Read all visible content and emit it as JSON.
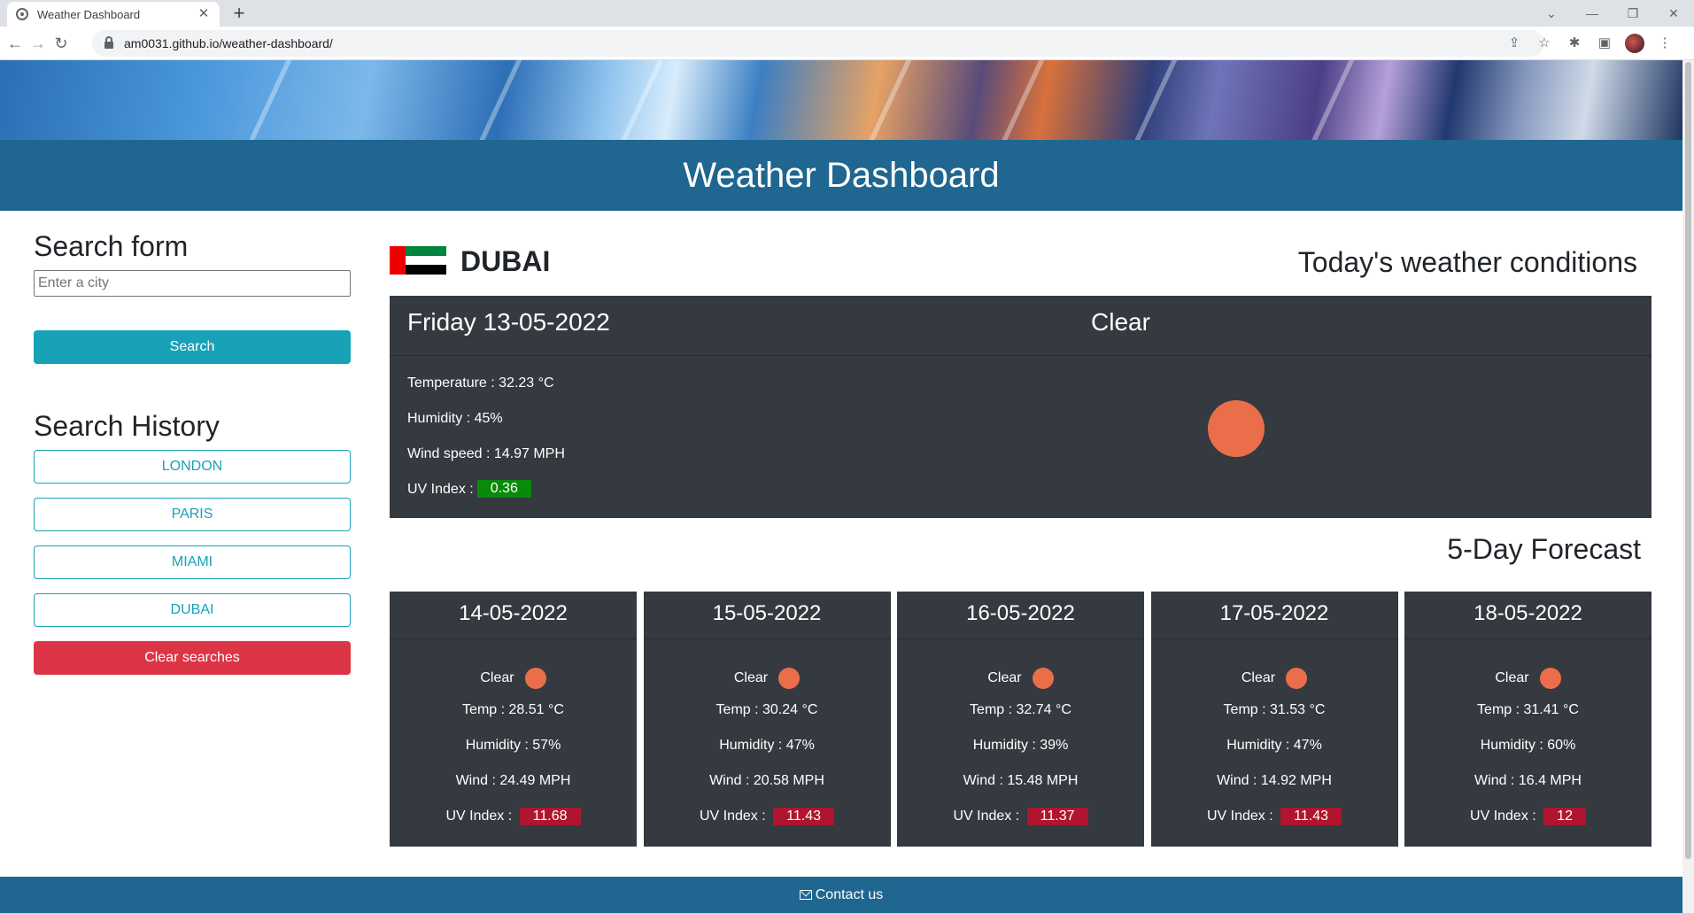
{
  "browser": {
    "tab_title": "Weather Dashboard",
    "tab_close": "✕",
    "new_tab": "+",
    "url": "am0031.github.io/weather-dashboard/"
  },
  "header": {
    "title": "Weather Dashboard"
  },
  "search": {
    "heading": "Search form",
    "placeholder": "Enter a city",
    "value": "",
    "button_label": "Search"
  },
  "history": {
    "heading": "Search History",
    "items": [
      "LONDON",
      "PARIS",
      "MIAMI",
      "DUBAI"
    ],
    "clear_label": "Clear searches"
  },
  "current": {
    "city": "DUBAI",
    "heading": "Today's weather conditions",
    "date": "Friday 13-05-2022",
    "condition": "Clear",
    "temperature": "Temperature : 32.23 °C",
    "humidity": "Humidity : 45%",
    "wind": "Wind speed : 14.97 MPH",
    "uv_label": "UV Index :",
    "uv_value": "0.36",
    "icon": "sun-icon"
  },
  "forecast": {
    "heading": "5-Day Forecast",
    "days": [
      {
        "date": "14-05-2022",
        "condition": "Clear",
        "temp": "Temp : 28.51 °C",
        "humidity": "Humidity : 57%",
        "wind": "Wind : 24.49 MPH",
        "uv_label": "UV Index :",
        "uv": "11.68"
      },
      {
        "date": "15-05-2022",
        "condition": "Clear",
        "temp": "Temp : 30.24 °C",
        "humidity": "Humidity : 47%",
        "wind": "Wind : 20.58 MPH",
        "uv_label": "UV Index :",
        "uv": "11.43"
      },
      {
        "date": "16-05-2022",
        "condition": "Clear",
        "temp": "Temp : 32.74 °C",
        "humidity": "Humidity : 39%",
        "wind": "Wind : 15.48 MPH",
        "uv_label": "UV Index :",
        "uv": "11.37"
      },
      {
        "date": "17-05-2022",
        "condition": "Clear",
        "temp": "Temp : 31.53 °C",
        "humidity": "Humidity : 47%",
        "wind": "Wind : 14.92 MPH",
        "uv_label": "UV Index :",
        "uv": "11.43"
      },
      {
        "date": "18-05-2022",
        "condition": "Clear",
        "temp": "Temp : 31.41 °C",
        "humidity": "Humidity : 60%",
        "wind": "Wind : 16.4 MPH",
        "uv_label": "UV Index :",
        "uv": "12"
      }
    ]
  },
  "footer": {
    "contact_label": "Contact us"
  },
  "colors": {
    "header_blue": "#1f6690",
    "card_dark": "#343a40",
    "accent_teal": "#17a2b8",
    "danger_red": "#dc3545",
    "uv_low_green": "#0a8a0a",
    "uv_high_red": "#b0152f",
    "sun_orange": "#eb6e4b"
  }
}
